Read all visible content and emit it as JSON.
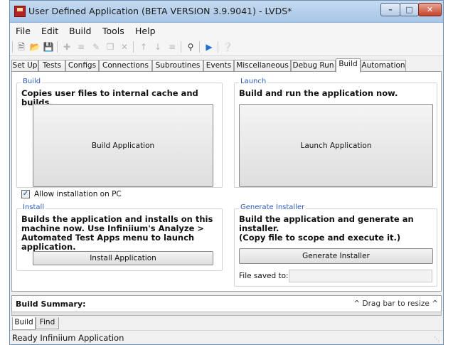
{
  "window": {
    "title": "User Defined Application (BETA VERSION 3.9.9041) - LVDS*"
  },
  "menu": [
    "File",
    "Edit",
    "Build",
    "Tools",
    "Help"
  ],
  "toolbar": {
    "icons": [
      "new-file-icon",
      "open-folder-icon",
      "save-icon",
      "add-icon",
      "add-sub-icon",
      "edit-icon",
      "copy-icon",
      "delete-icon",
      "move-up-icon",
      "move-down-icon",
      "insert-icon",
      "search-icon",
      "run-icon",
      "help-icon"
    ]
  },
  "tabs": [
    "Set Up",
    "Tests",
    "Configs",
    "Connections",
    "Subroutines",
    "Events",
    "Miscellaneous",
    "Debug Run",
    "Build",
    "Automation"
  ],
  "active_tab": "Build",
  "build": {
    "label": "Build",
    "desc": "Copies user files to internal cache and builds.",
    "button": "Build Application"
  },
  "launch": {
    "label": "Launch",
    "desc": "Build and run the application now.",
    "button": "Launch Application"
  },
  "allow": {
    "label": "Allow installation on PC",
    "checked": true
  },
  "install": {
    "label": "Install",
    "desc_lines": [
      "Builds the application and installs on this",
      "machine now. Use Infiniium's Analyze >",
      "Automated Test Apps menu to launch application."
    ],
    "button": "Install Application"
  },
  "installer": {
    "label": "Generate Installer",
    "desc_lines": [
      "Build the application and generate an installer.",
      "(Copy file to scope and execute it.)"
    ],
    "button": "Generate Installer",
    "file_label": "File saved to:",
    "file_value": ""
  },
  "summary": {
    "title": "Build Summary:",
    "hint": "^ Drag bar to resize ^"
  },
  "bottom_tabs": [
    "Build",
    "Find"
  ],
  "status": "Ready  Infiniium  Application",
  "colors": {
    "group_label": "#2c5bb8",
    "title_bar": "#a8c6e6",
    "close_button": "#c4412b"
  }
}
